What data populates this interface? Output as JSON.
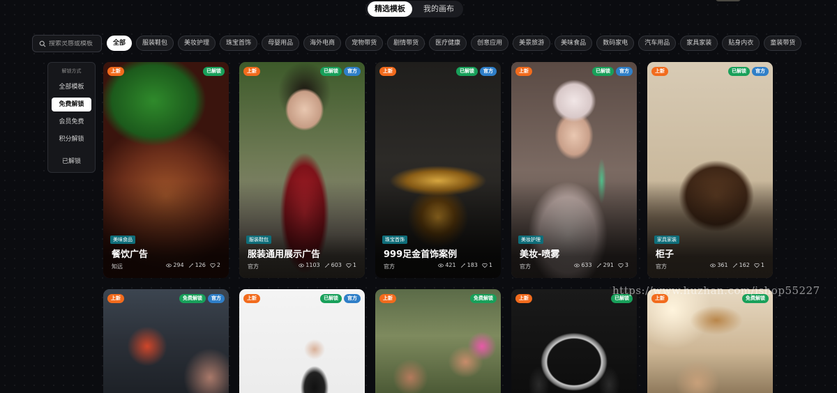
{
  "top_tabs": [
    {
      "label": "精选模板",
      "active": true
    },
    {
      "label": "我的画布",
      "active": false
    }
  ],
  "search": {
    "placeholder": "搜索灵感或模板",
    "icon": "search-icon"
  },
  "categories": [
    "全部",
    "服装鞋包",
    "美妆护理",
    "珠宝首饰",
    "母婴用品",
    "海外电商",
    "宠物带货",
    "剧情带货",
    "医疗健康",
    "创意应用",
    "美景旅游",
    "美味食品",
    "数码家电",
    "汽车用品",
    "家具家装",
    "贴身内衣",
    "童装带货"
  ],
  "active_category": 0,
  "filter": {
    "title": "解锁方式",
    "items": [
      "全部模板",
      "免费解锁",
      "会员免费",
      "积分解锁"
    ],
    "active_index": 1,
    "extra": "已解锁"
  },
  "colors": {
    "new_badge": "#f26b1d",
    "unlocked_badge": "#18a05a",
    "official_badge": "#2f7fc8",
    "tag_bg": "#0f6e7a"
  },
  "cards_row1": [
    {
      "new": "上新",
      "status": "已解锁",
      "official": "",
      "tag": "美味食品",
      "title": "餐饮广告",
      "author": "知远",
      "views": "294",
      "uses": "126",
      "likes": "2"
    },
    {
      "new": "上新",
      "status": "已解锁",
      "official": "官方",
      "tag": "服装鞋包",
      "title": "服装通用展示广告",
      "author": "官方",
      "views": "1103",
      "uses": "603",
      "likes": "1"
    },
    {
      "new": "上新",
      "status": "已解锁",
      "official": "官方",
      "tag": "珠宝首饰",
      "title": "999足金首饰案例",
      "author": "官方",
      "views": "421",
      "uses": "183",
      "likes": "1"
    },
    {
      "new": "上新",
      "status": "已解锁",
      "official": "官方",
      "tag": "美妆护理",
      "title": "美妆-喷雾",
      "author": "官方",
      "views": "633",
      "uses": "291",
      "likes": "3"
    },
    {
      "new": "上新",
      "status": "已解锁",
      "official": "官方",
      "tag": "家具家装",
      "title": "柜子",
      "author": "官方",
      "views": "361",
      "uses": "162",
      "likes": "1"
    }
  ],
  "cards_row2": [
    {
      "new": "上新",
      "status": "免费解锁",
      "official": "官方"
    },
    {
      "new": "上新",
      "status": "已解锁",
      "official": "官方"
    },
    {
      "new": "上新",
      "status": "免费解锁",
      "official": ""
    },
    {
      "new": "上新",
      "status": "已解锁",
      "official": ""
    },
    {
      "new": "上新",
      "status": "免费解锁",
      "official": ""
    }
  ],
  "watermark": "https://www.huzhan.com/ishop55227"
}
